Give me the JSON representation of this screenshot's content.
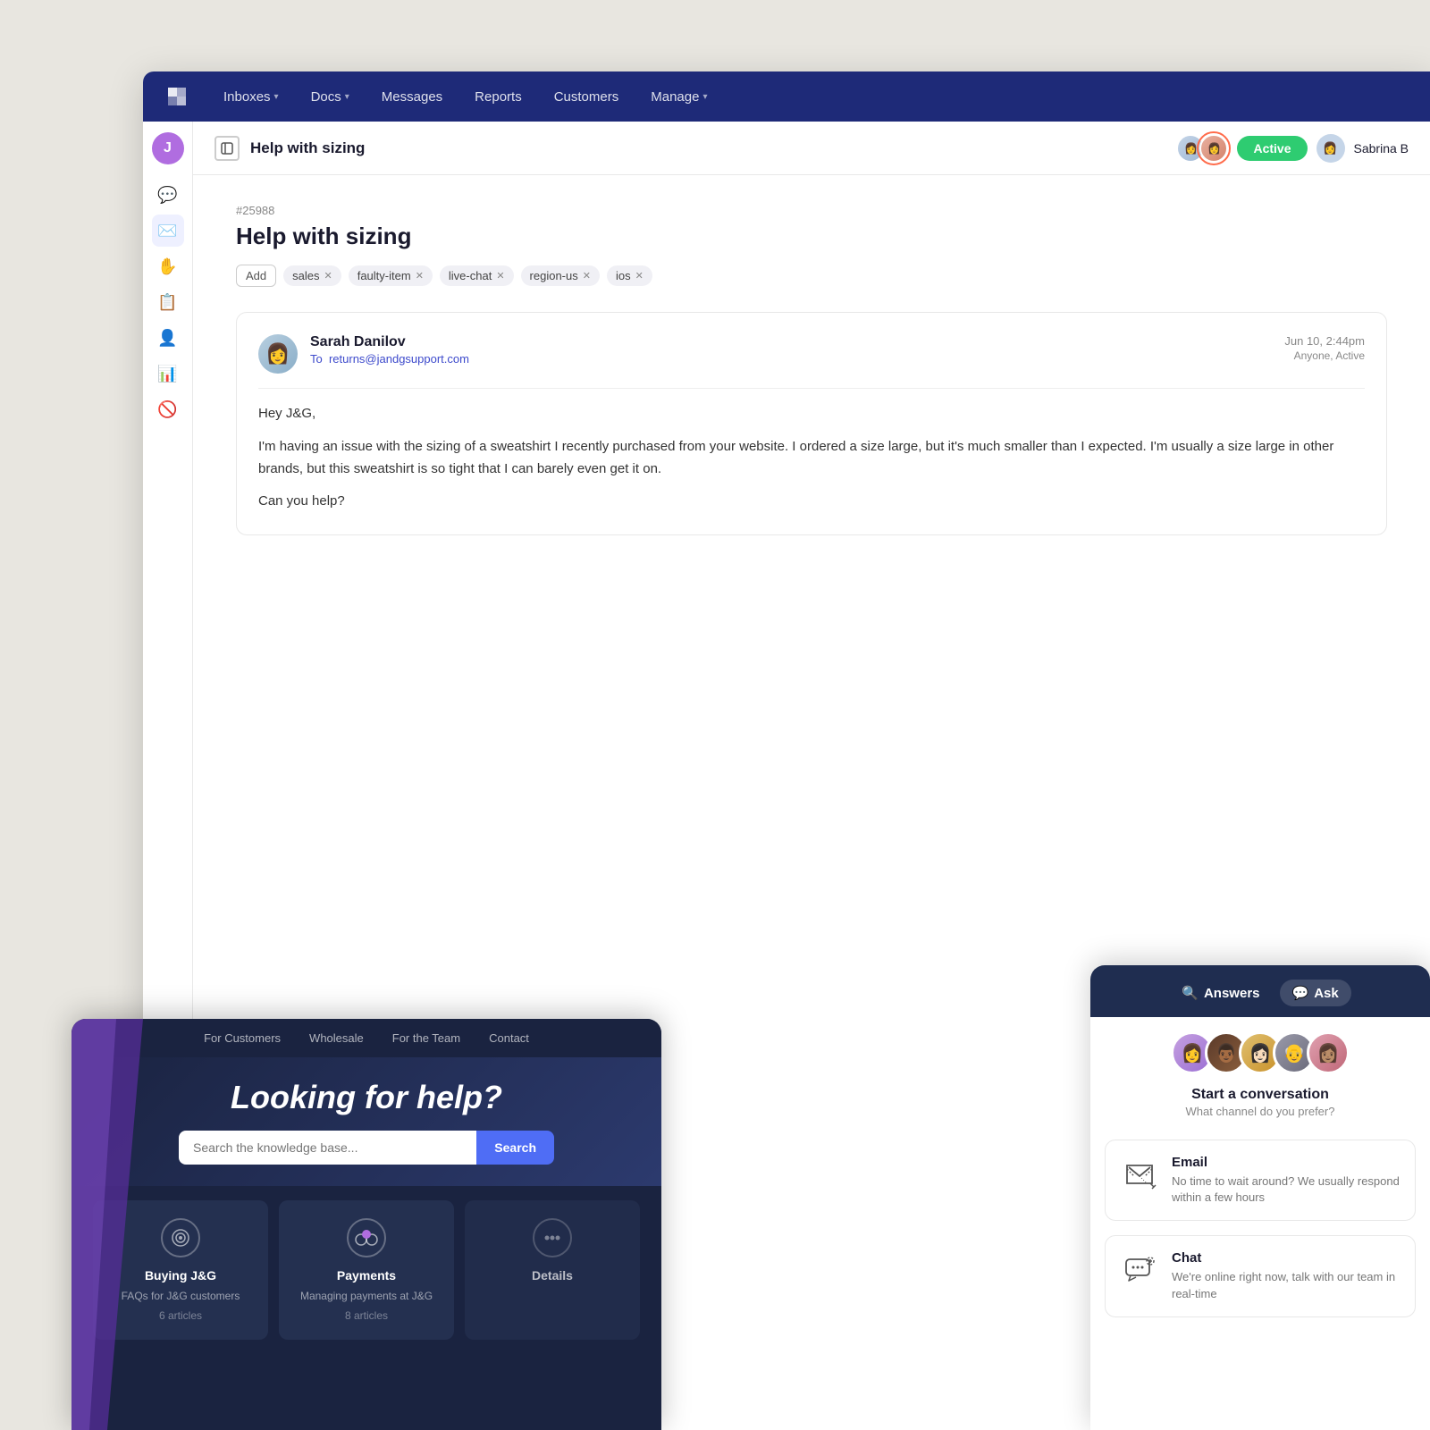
{
  "nav": {
    "logo_symbol": "//",
    "items": [
      {
        "label": "Inboxes",
        "has_chevron": true
      },
      {
        "label": "Docs",
        "has_chevron": true
      },
      {
        "label": "Messages",
        "has_chevron": false
      },
      {
        "label": "Reports",
        "has_chevron": false
      },
      {
        "label": "Customers",
        "has_chevron": false
      },
      {
        "label": "Manage",
        "has_chevron": true
      }
    ]
  },
  "sidebar": {
    "user_initial": "J",
    "icons": [
      {
        "name": "chat-icon",
        "symbol": "💬",
        "active": false
      },
      {
        "name": "inbox-icon",
        "symbol": "✉️",
        "active": true
      },
      {
        "name": "hand-icon",
        "symbol": "✋",
        "active": false
      },
      {
        "name": "copy-icon",
        "symbol": "📋",
        "active": false
      },
      {
        "name": "contact-icon",
        "symbol": "👤",
        "active": false
      },
      {
        "name": "report-icon",
        "symbol": "📊",
        "active": false
      },
      {
        "name": "block-icon",
        "symbol": "🚫",
        "active": false
      }
    ]
  },
  "conversation": {
    "ticket_id": "#25988",
    "title": "Help with sizing",
    "tags": [
      "sales",
      "faulty-item",
      "live-chat",
      "region-us",
      "ios"
    ],
    "active_badge": "Active",
    "agent_name": "Sabrina B",
    "message": {
      "sender": "Sarah Danilov",
      "to_label": "To",
      "to_email": "returns@jandgsupport.com",
      "date": "Jun 10, 2:44pm",
      "status": "Anyone, Active",
      "greeting": "Hey J&G,",
      "body_line1": "I'm having an issue with the sizing of a sweatshirt I recently purchased from your website. I ordered a size large, but it's much smaller than I expected. I'm usually a size large in other brands, but this sweatshirt is so tight that I can barely even get it on.",
      "body_line2": "Can you help?"
    }
  },
  "help_center": {
    "nav_items": [
      "For Customers",
      "Wholesale",
      "For the Team",
      "Contact"
    ],
    "hero_title": "Looking for help?",
    "search_placeholder": "Search the knowledge base...",
    "search_button": "Search",
    "categories": [
      {
        "name": "Buying J&G",
        "desc": "FAQs for J&G customers",
        "count": "6 articles",
        "icon_type": "circle-target"
      },
      {
        "name": "Payments",
        "desc": "Managing payments at J&G",
        "count": "8 articles",
        "icon_type": "circles-group"
      },
      {
        "name": "Details",
        "desc": "",
        "count": "",
        "icon_type": "dots"
      }
    ]
  },
  "chat_widget": {
    "tabs": [
      {
        "label": "Answers",
        "icon": "🔍",
        "active": false
      },
      {
        "label": "Ask",
        "icon": "💬",
        "active": true
      }
    ],
    "start_title": "Start a conversation",
    "start_subtitle": "What channel do you prefer?",
    "channels": [
      {
        "name": "Email",
        "desc": "No time to wait around? We usually respond within a few hours",
        "icon_type": "email"
      },
      {
        "name": "Chat",
        "desc": "We're online right now, talk with our team in real-time",
        "icon_type": "chat"
      }
    ],
    "agents": [
      {
        "color": "av-purple"
      },
      {
        "color": "av-brown"
      },
      {
        "color": "av-gold"
      },
      {
        "color": "av-gray"
      },
      {
        "color": "av-pink"
      }
    ]
  }
}
